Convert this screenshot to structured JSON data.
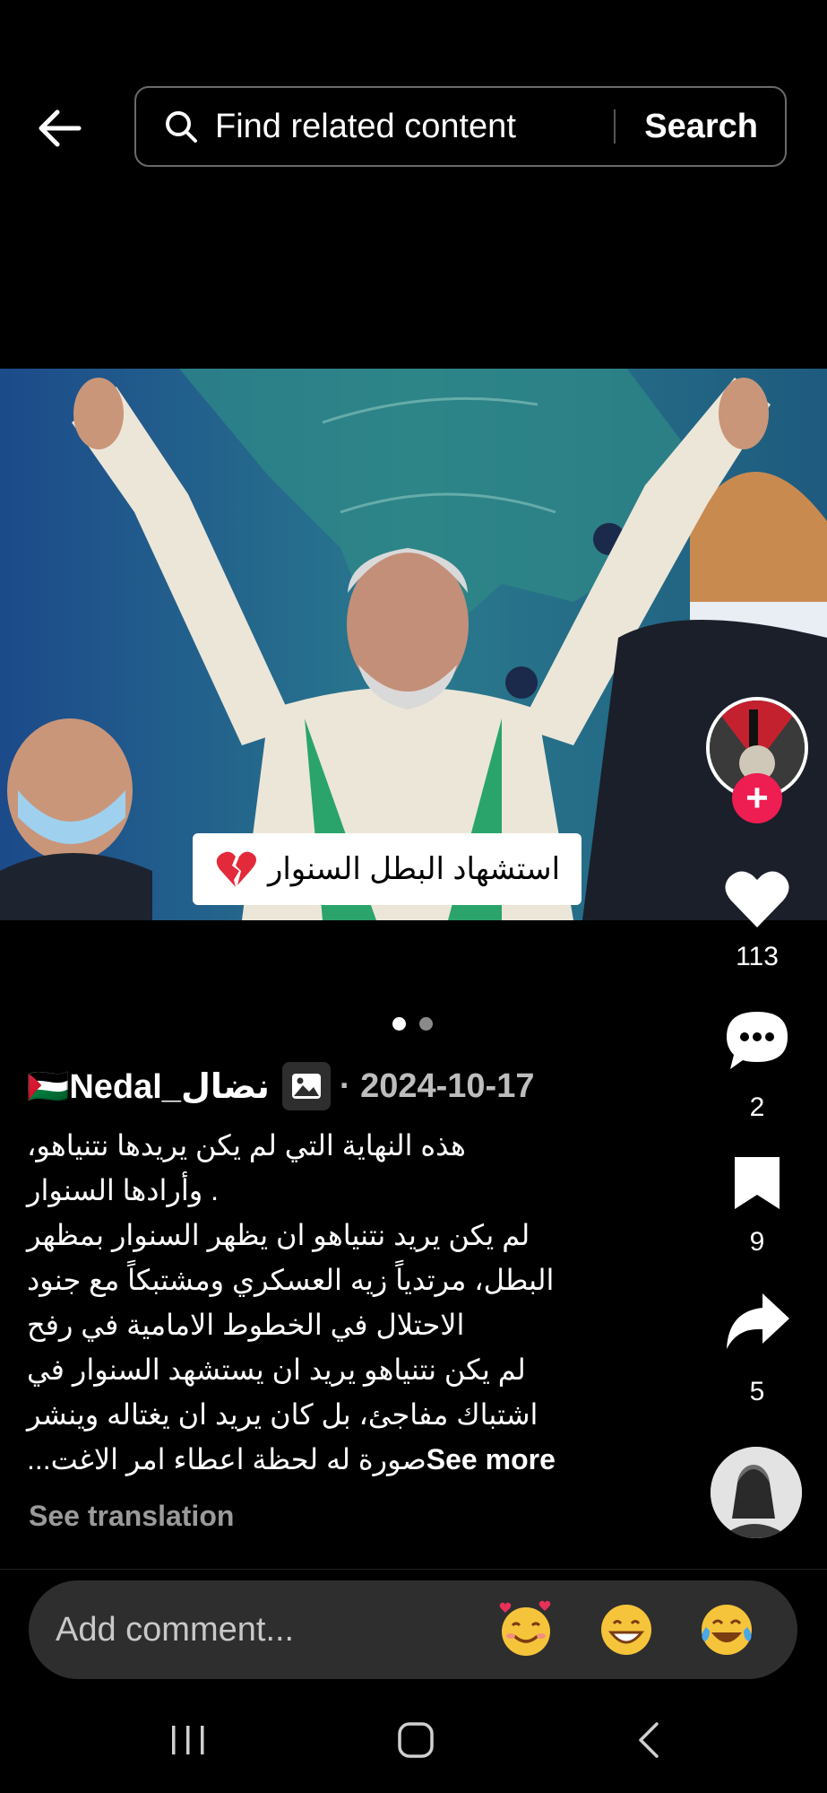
{
  "search": {
    "placeholder": "Find related content",
    "button": "Search"
  },
  "post": {
    "caption_overlay": "استشهاد البطل السنوار",
    "username": "🇵🇸Nedal_نضال",
    "date": "· 2024-10-17",
    "description_lines": [
      "هذه النهاية التي لم يكن يريدها نتنياهو،",
      ". وأرادها السنوار",
      "لم يكن يريد نتنياهو ان يظهر السنوار بمظهر",
      "البطل، مرتدياً زيه العسكري ومشتبكاً مع جنود",
      "الاحتلال في الخطوط الامامية في رفح",
      "لم يكن نتنياهو يريد ان يستشهد السنوار في",
      "اشتباك مفاجئ، بل كان يريد ان يغتاله وينشر",
      "صورة له لحظة اعطاء امر الاغت..."
    ],
    "see_more": "See more",
    "see_translation": "See translation"
  },
  "actions": {
    "likes": "113",
    "comments": "2",
    "saves": "9",
    "shares": "5"
  },
  "comment": {
    "placeholder": "Add comment..."
  },
  "colors": {
    "accent": "#ee1d52",
    "background": "#000000",
    "input_bg": "#2e2e2e"
  }
}
